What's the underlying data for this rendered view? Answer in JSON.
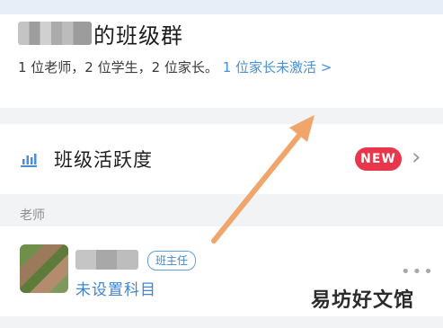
{
  "header": {
    "title": "的班级群",
    "summary": "1 位老师，2 位学生，2 位家长。",
    "summary_link": "1 位家长未激活 >"
  },
  "activity": {
    "label": "班级活跃度",
    "badge": "NEW",
    "chevron": "›",
    "icon": "bar-chart-icon"
  },
  "sections": {
    "teacher_header": "老师"
  },
  "teacher": {
    "role": "班主任",
    "subject": "未设置科目",
    "more": "•••"
  },
  "watermark": "易坊好文馆",
  "colors": {
    "accent_blue": "#4a8fd6",
    "badge_red": "#e8374a",
    "annotation_arrow": "#f0a66a"
  }
}
